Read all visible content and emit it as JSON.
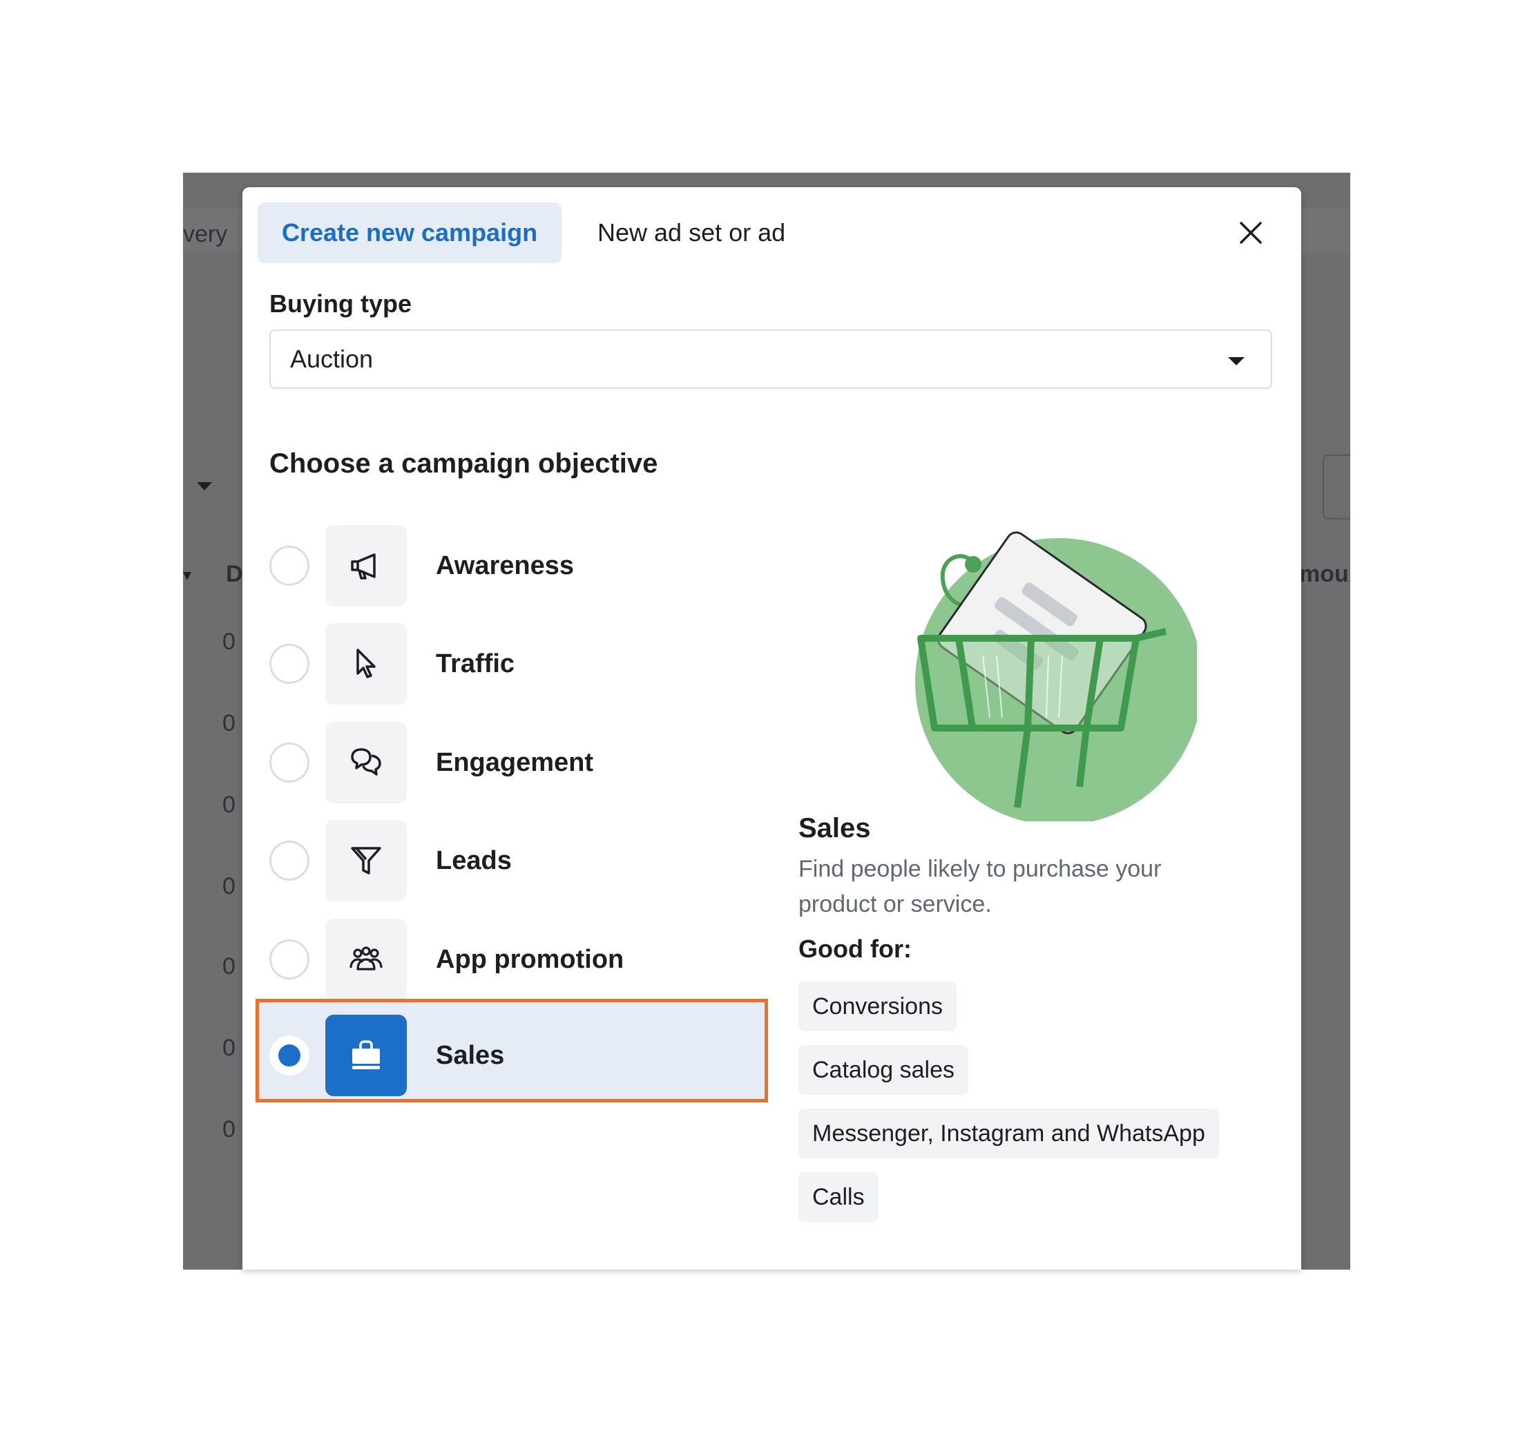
{
  "background": {
    "left_fragment": "very",
    "col_fragment": "D",
    "right_fragment": "mou",
    "row_values": [
      "0",
      "0",
      "0",
      "0",
      "0",
      "0",
      "0"
    ]
  },
  "tabs": {
    "create_campaign": "Create new campaign",
    "new_ad_set_or_ad": "New ad set or ad"
  },
  "buying_type": {
    "label": "Buying type",
    "value": "Auction"
  },
  "objective_heading": "Choose a campaign objective",
  "objectives": [
    {
      "label": "Awareness",
      "icon": "megaphone-icon",
      "selected": false
    },
    {
      "label": "Traffic",
      "icon": "cursor-icon",
      "selected": false
    },
    {
      "label": "Engagement",
      "icon": "chat-bubbles-icon",
      "selected": false
    },
    {
      "label": "Leads",
      "icon": "funnel-icon",
      "selected": false
    },
    {
      "label": "App promotion",
      "icon": "people-group-icon",
      "selected": false
    },
    {
      "label": "Sales",
      "icon": "shopping-bag-icon",
      "selected": true
    }
  ],
  "detail": {
    "title": "Sales",
    "description": "Find people likely to purchase your product or service.",
    "good_for_label": "Good for:",
    "good_for": [
      "Conversions",
      "Catalog sales",
      "Messenger, Instagram and WhatsApp",
      "Calls"
    ]
  },
  "colors": {
    "accent": "#1b6fc8",
    "selected_bg": "#e6ecf5",
    "highlight_frame": "#e8722c",
    "illustration_green": "#8dc78f"
  }
}
